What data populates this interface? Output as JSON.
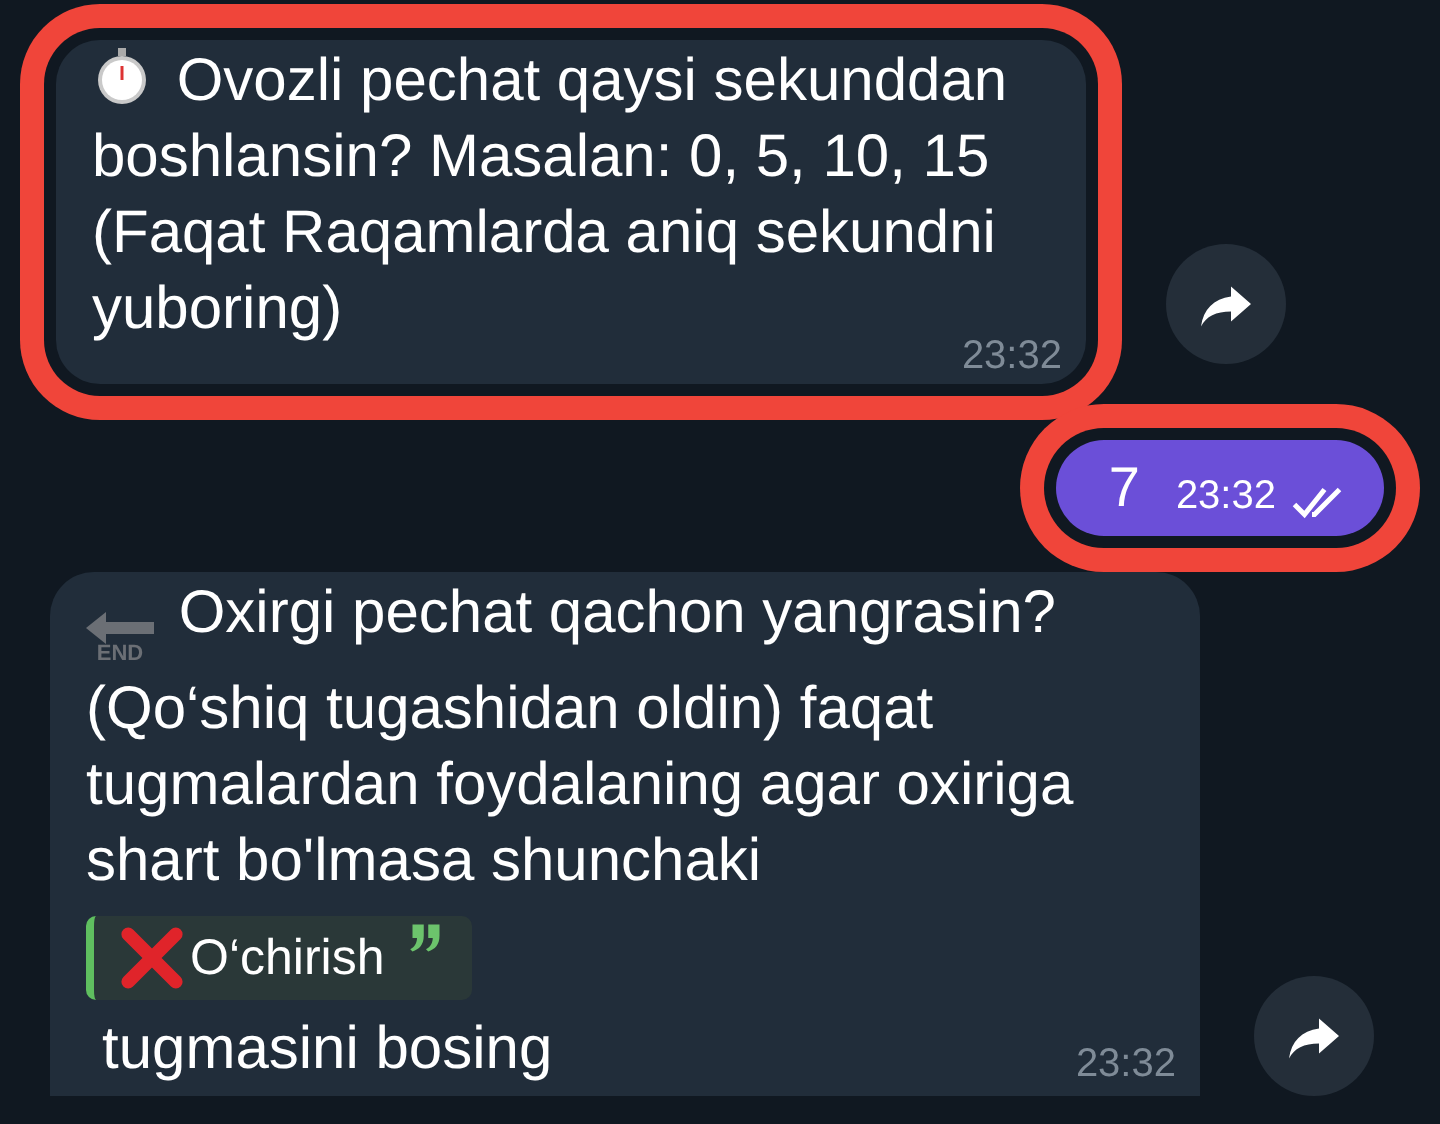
{
  "messages": [
    {
      "kind": "incoming",
      "highlighted": true,
      "text": "Ovozli pechat qaysi sekunddan boshlansin? Masalan: 0, 5, 10, 15 (Faqat Raqamlarda aniq sekundni yuboring)",
      "time": "23:32",
      "forward": true
    },
    {
      "kind": "outgoing",
      "highlighted": true,
      "text": "7",
      "time": "23:32",
      "read": true
    },
    {
      "kind": "incoming",
      "highlighted": false,
      "icon_text": "END",
      "text": "Oxirgi pechat qachon yangrasin? (Qo‘shiq tugashidan oldin) faqat tugmalardan foydalaning agar oxiriga shart bo'lmasa shunchaki",
      "quote": "O‘chirish",
      "after": "tugmasini bosing",
      "time": "23:32",
      "forward": true
    }
  ]
}
